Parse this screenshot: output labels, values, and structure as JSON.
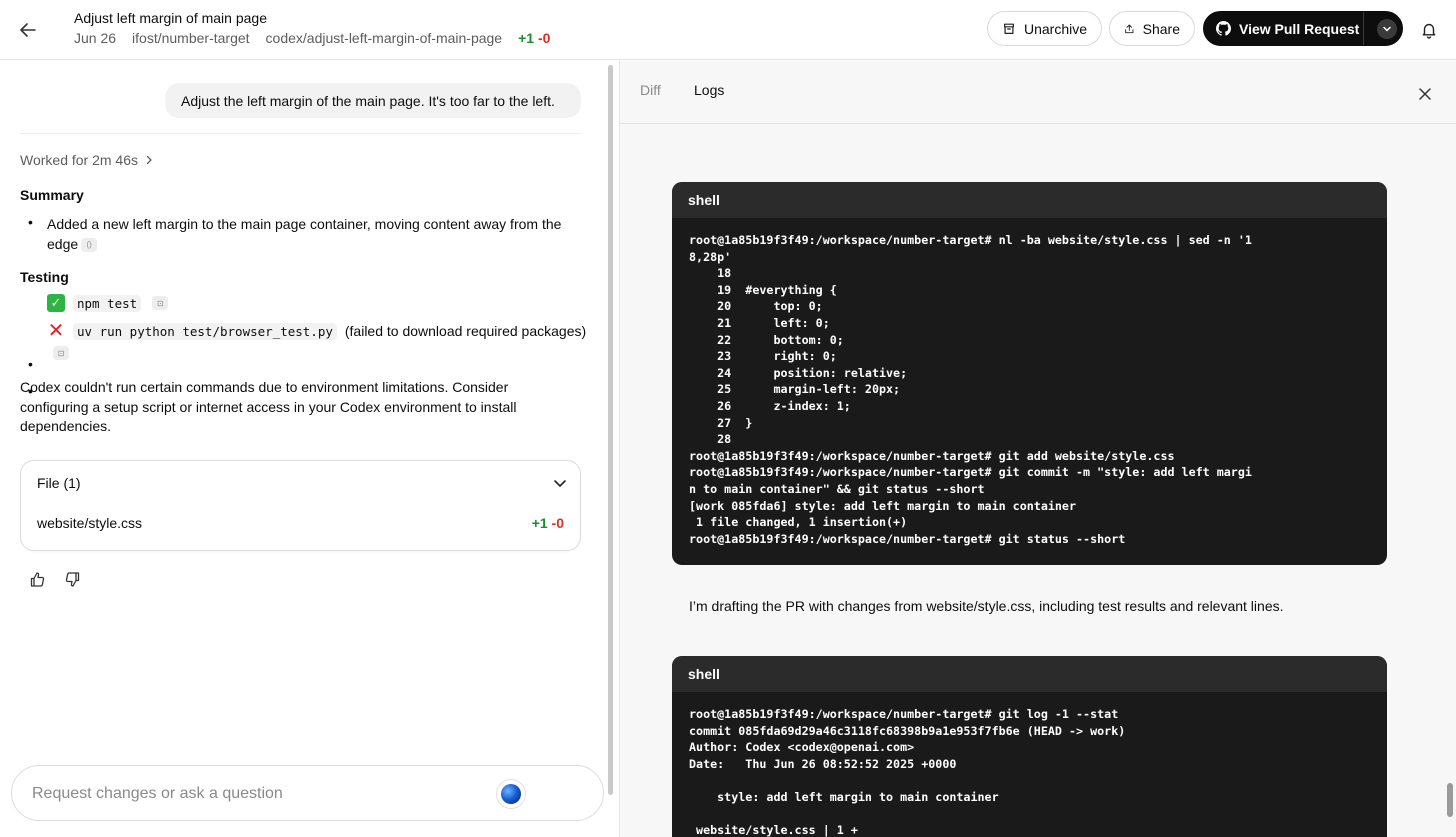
{
  "header": {
    "title": "Adjust left margin of main page",
    "date": "Jun 26",
    "repo": "ifost/number-target",
    "branch": "codex/adjust-left-margin-of-main-page",
    "diff_plus": "+1",
    "diff_minus": "-0",
    "unarchive_label": "Unarchive",
    "share_label": "Share",
    "view_pr_label": "View Pull Request"
  },
  "chat": {
    "user_message": "Adjust the left margin of the main page. It's too far to the left.",
    "worked_for": "Worked for 2m 46s",
    "summary_heading": "Summary",
    "summary_item": "Added a new left margin to the main page container, moving content away from the edge",
    "testing_heading": "Testing",
    "test1_cmd": "npm test",
    "test2_cmd": "uv run python test/browser_test.py",
    "test2_note": "(failed to download required packages)",
    "paragraph": "Codex couldn't run certain commands due to environment limitations. Consider configuring a setup script or internet access in your Codex environment to install dependencies.",
    "files_heading": "File (1)",
    "file_name": "website/style.css",
    "file_plus": "+1",
    "file_minus": "-0",
    "input_placeholder": "Request changes or ask a question"
  },
  "panel": {
    "tab_diff": "Diff",
    "tab_logs": "Logs",
    "shell1_label": "shell",
    "shell1_output": "root@1a85b19f3f49:/workspace/number-target# nl -ba website/style.css | sed -n '1\n8,28p'\n    18\n    19  #everything {\n    20      top: 0;\n    21      left: 0;\n    22      bottom: 0;\n    23      right: 0;\n    24      position: relative;\n    25      margin-left: 20px;\n    26      z-index: 1;\n    27  }\n    28\nroot@1a85b19f3f49:/workspace/number-target# git add website/style.css\nroot@1a85b19f3f49:/workspace/number-target# git commit -m \"style: add left margi\nn to main container\" && git status --short\n[work 085fda6] style: add left margin to main container\n 1 file changed, 1 insertion(+)\nroot@1a85b19f3f49:/workspace/number-target# git status --short",
    "log_note": "I’m drafting the PR with changes from website/style.css, including test results and relevant lines.",
    "shell2_label": "shell",
    "shell2_output": "root@1a85b19f3f49:/workspace/number-target# git log -1 --stat\ncommit 085fda69d29a46c3118fc68398b9a1e953f7fb6e (HEAD -> work)\nAuthor: Codex <codex@openai.com>\nDate:   Thu Jun 26 08:52:52 2025 +0000\n\n    style: add left margin to main container\n\n website/style.css | 1 +"
  },
  "colors": {
    "addition": "#1a8f2f",
    "deletion": "#d93025",
    "shell_bg": "#1a1a1a",
    "primary_button": "#0d0d0d"
  },
  "icons": {
    "back": "arrow-left-icon",
    "unarchive": "archive-box-icon",
    "share": "share-upload-icon",
    "pr": "github-icon",
    "bell": "bell-icon",
    "close": "close-icon"
  }
}
